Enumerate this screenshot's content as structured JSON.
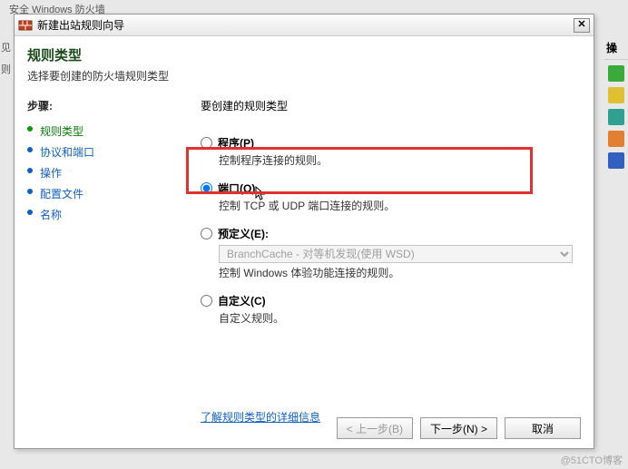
{
  "background": {
    "title": "安全 Windows 防火墙"
  },
  "dialog": {
    "title": "新建出站规则向导",
    "page_title": "规则类型",
    "page_subtitle": "选择要创建的防火墙规则类型"
  },
  "sidebar": {
    "heading": "步骤:",
    "items": [
      {
        "label": "规则类型",
        "current": true
      },
      {
        "label": "协议和端口",
        "current": false
      },
      {
        "label": "操作",
        "current": false
      },
      {
        "label": "配置文件",
        "current": false
      },
      {
        "label": "名称",
        "current": false
      }
    ]
  },
  "panel": {
    "heading": "要创建的规则类型",
    "options": [
      {
        "id": "program",
        "label": "程序(P)",
        "desc": "控制程序连接的规则。",
        "checked": false
      },
      {
        "id": "port",
        "label": "端口(O)",
        "desc": "控制 TCP 或 UDP 端口连接的规则。",
        "checked": true
      },
      {
        "id": "predefined",
        "label": "预定义(E):",
        "desc": "控制 Windows 体验功能连接的规则。",
        "select_value": "BranchCache - 对等机发现(使用 WSD)",
        "checked": false
      },
      {
        "id": "custom",
        "label": "自定义(C)",
        "desc": "自定义规则。",
        "checked": false
      }
    ],
    "learn_more": "了解规则类型的详细信息"
  },
  "buttons": {
    "back": "< 上一步(B)",
    "next": "下一步(N) >",
    "cancel": "取消"
  },
  "right_strip": {
    "heading": "操"
  },
  "left_strip": {
    "l1": "见",
    "l2": "则"
  },
  "watermark": "@51CTO博客"
}
